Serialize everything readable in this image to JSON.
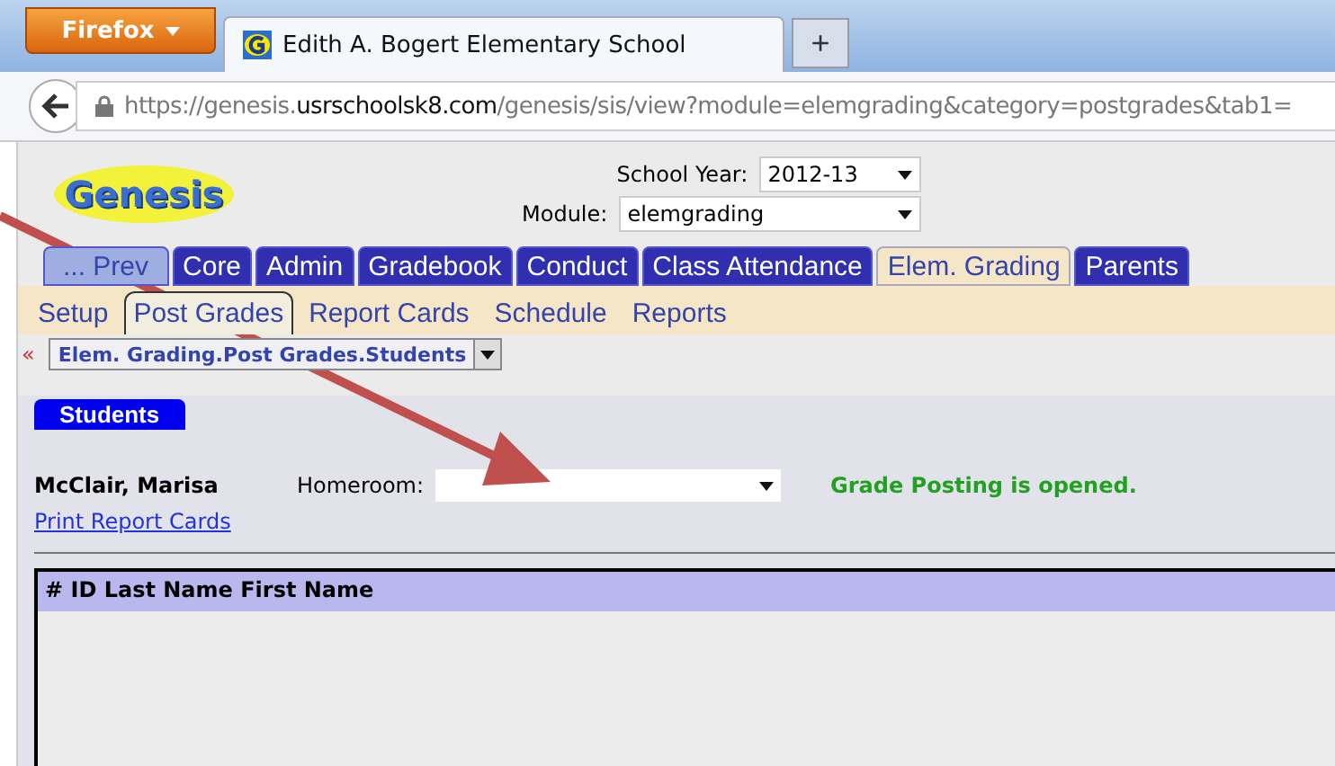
{
  "browser": {
    "menu_button": "Firefox",
    "tabs": [
      {
        "title": "Edith A. Bogert Elementary School",
        "selected": true
      }
    ],
    "new_tab": "+",
    "url": {
      "scheme": "https://genesis.",
      "domain": "usrschoolsk8.com",
      "path": "/genesis/sis/view?module=elemgrading&category=postgrades&tab1="
    }
  },
  "header": {
    "logo": "Genesis",
    "school_year": {
      "label": "School Year:",
      "value": "2012-13"
    },
    "module": {
      "label": "Module:",
      "value": "elemgrading"
    }
  },
  "tabs": [
    {
      "label": "... Prev",
      "kind": "prev",
      "selected": false
    },
    {
      "label": "Core",
      "kind": "tab",
      "selected": false
    },
    {
      "label": "Admin",
      "kind": "tab",
      "selected": false
    },
    {
      "label": "Gradebook",
      "kind": "tab",
      "selected": false
    },
    {
      "label": "Conduct",
      "kind": "tab",
      "selected": false
    },
    {
      "label": "Class Attendance",
      "kind": "tab",
      "selected": false
    },
    {
      "label": "Elem. Grading",
      "kind": "tab",
      "selected": true
    },
    {
      "label": "Parents",
      "kind": "tab",
      "selected": false
    }
  ],
  "subtabs": [
    {
      "label": "Setup",
      "selected": false
    },
    {
      "label": "Post Grades",
      "selected": true
    },
    {
      "label": "Report Cards",
      "selected": false
    },
    {
      "label": "Schedule",
      "selected": false
    },
    {
      "label": "Reports",
      "selected": false
    }
  ],
  "breadcrumb": {
    "back": "«",
    "value": "Elem. Grading.Post Grades.Students"
  },
  "panel": {
    "tab": "Students",
    "teacher": "McClair, Marisa",
    "homeroom_label": "Homeroom:",
    "status": "Grade Posting is opened.",
    "link": "Print Report Cards",
    "table": {
      "header": "# ID Last Name First Name"
    }
  }
}
